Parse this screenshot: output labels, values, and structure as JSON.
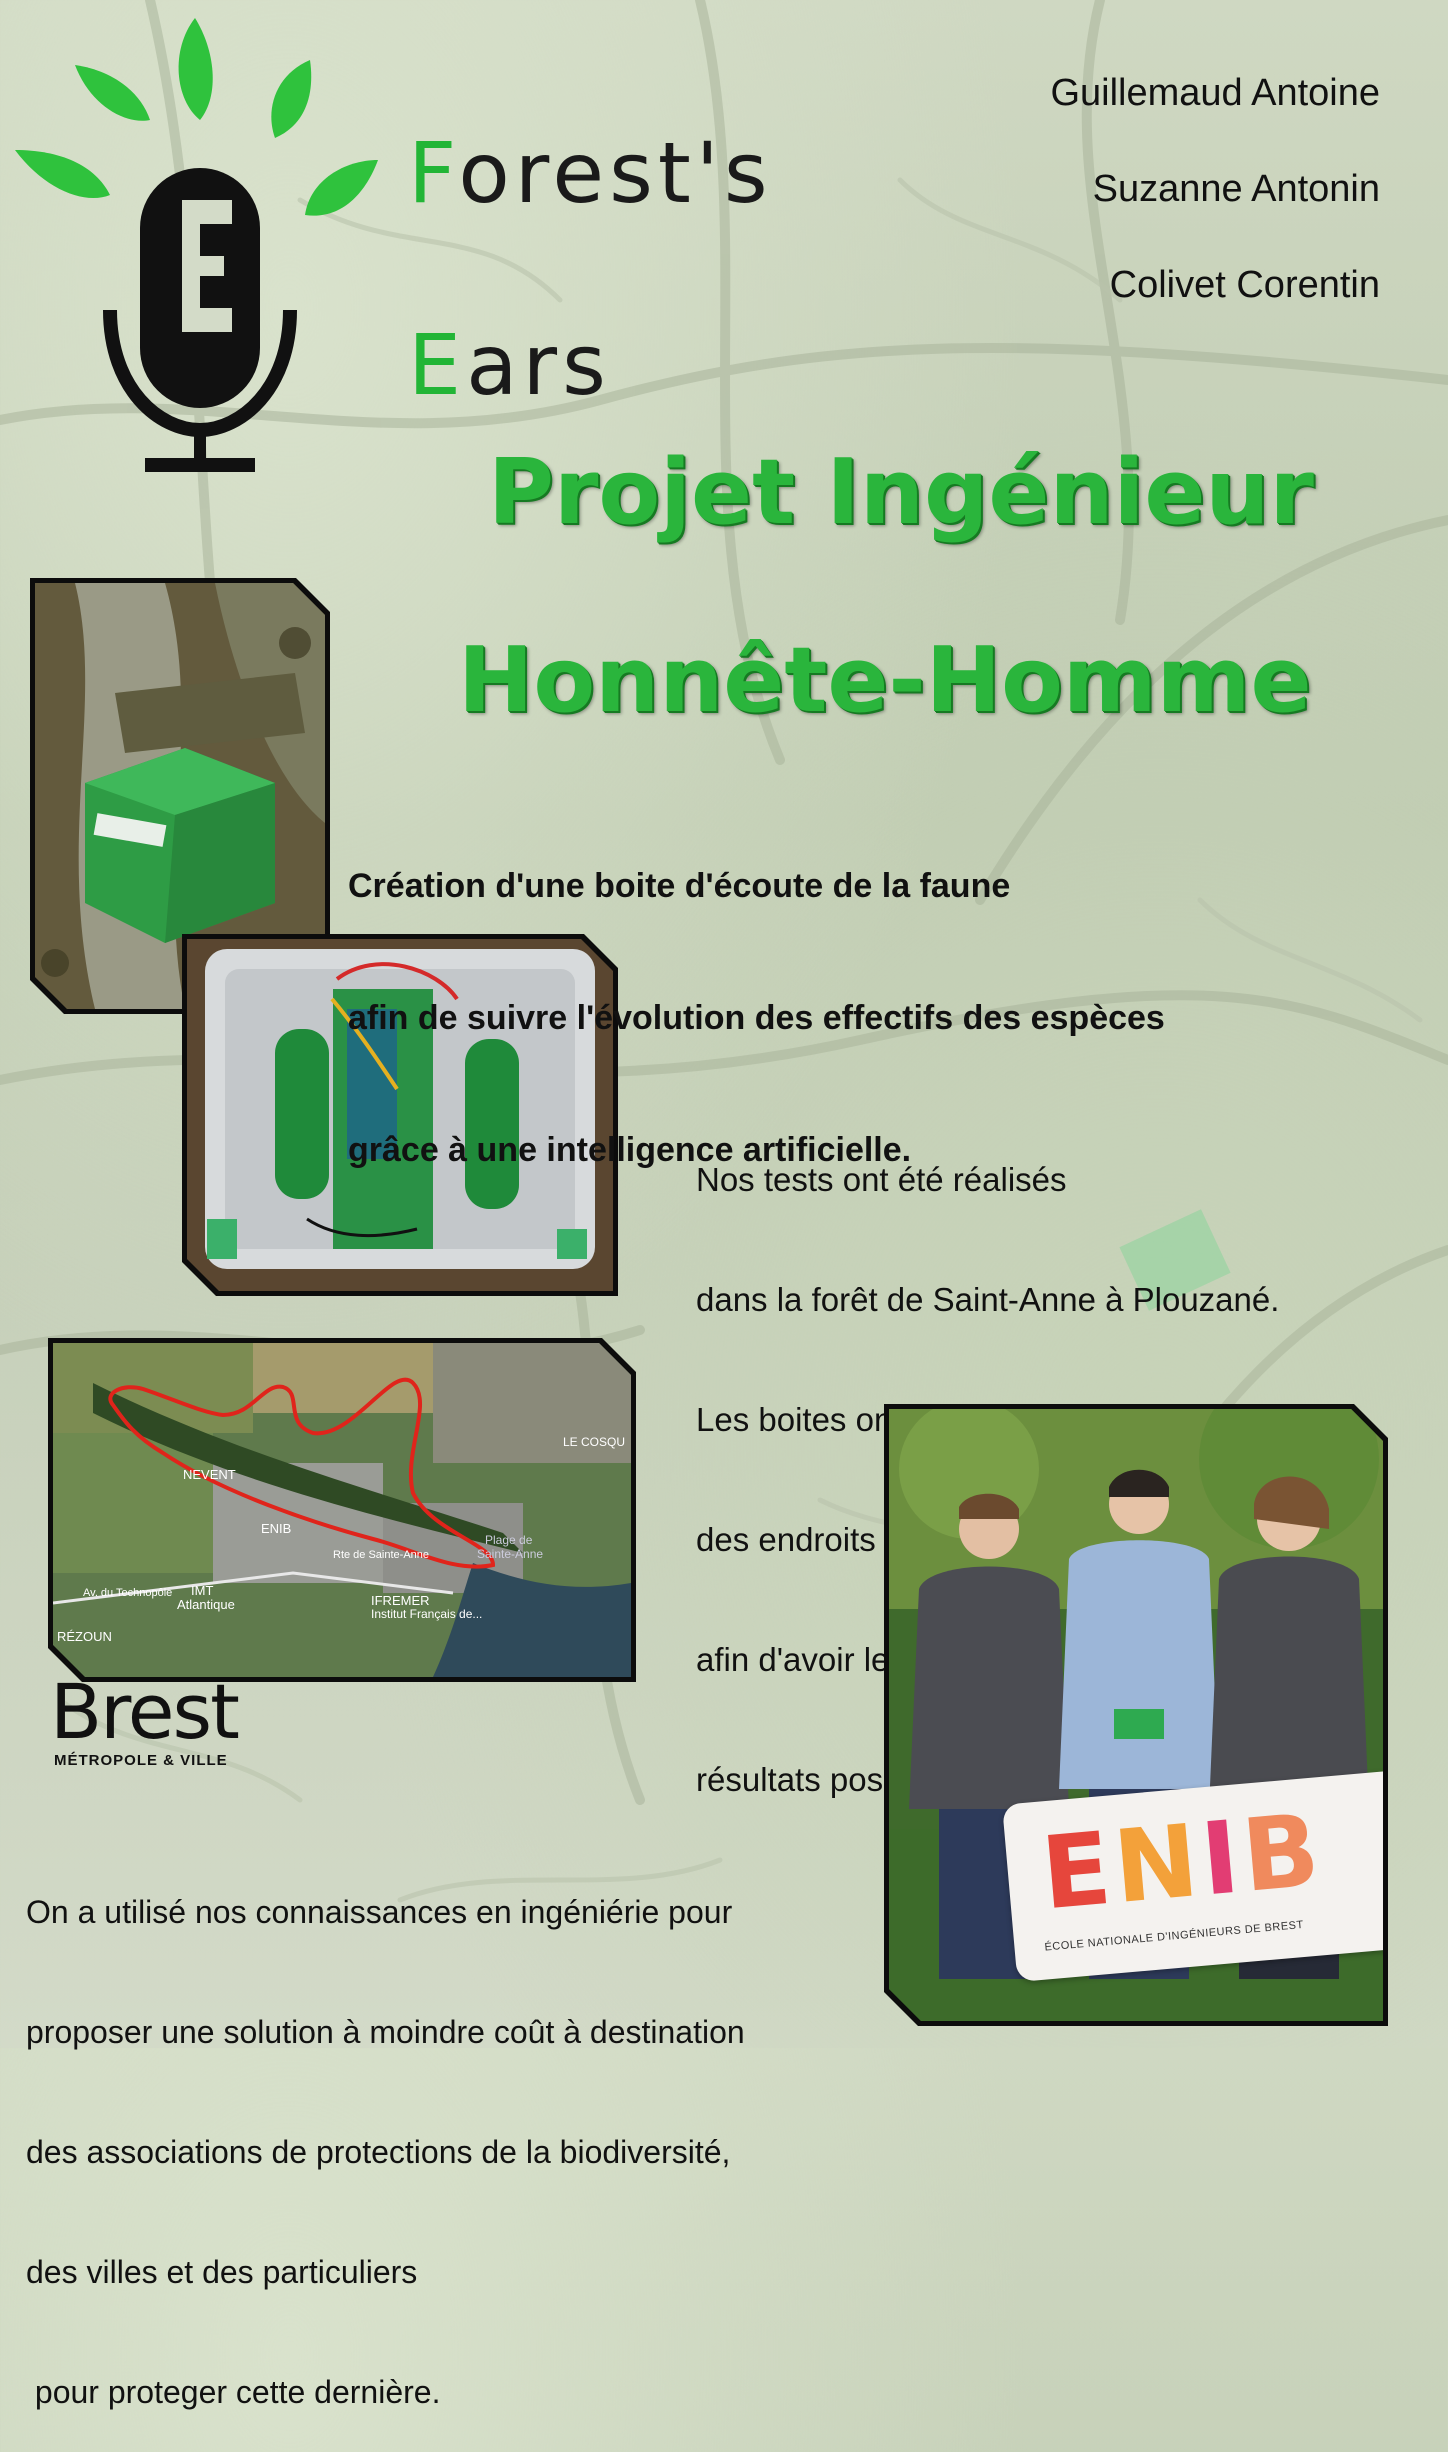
{
  "brand": {
    "word1_cap": "F",
    "word1_rest": "orest's",
    "word2_cap": "E",
    "word2_rest": "ars"
  },
  "authors": [
    "Guillemaud Antoine",
    "Suzanne Antonin",
    "Colivet Corentin"
  ],
  "headline": {
    "line1": "Projet Ingénieur",
    "line2": "Honnête-Homme"
  },
  "intro": {
    "lines": [
      "Création d'une boite d'écoute de la faune",
      "afin de suivre l'évolution des effectifs des espèces",
      "grâce à une intelligence artificielle."
    ]
  },
  "tests": {
    "lines": [
      "Nos tests ont été réalisés",
      "dans la forêt de Saint-Anne à Plouzané.",
      "Les boites ont été installées à",
      "des endroits stratégiques",
      "afin d'avoir les meilleurs",
      "résultats possibles."
    ]
  },
  "conclusion": {
    "lines": [
      "On a utilisé nos connaissances en ingéniérie pour",
      "proposer une solution à moindre coût à destination",
      "des associations de protections de la biodiversité,",
      "des villes et des particuliers",
      " pour proteger cette dernière."
    ]
  },
  "map_labels": {
    "nevent": "NEVENT",
    "enib": "ENIB",
    "imt": "IMT",
    "imt2": "Atlantique",
    "ifremer": "IFREMER",
    "ifremer2": "Institut Français de...",
    "cosqu": "LE COSQU",
    "rezoun": "RÉZOUN",
    "technopole": "Av. du Technopôle",
    "rte": "Rte de Sainte-Anne",
    "plage": "Plage de",
    "plage2": "Sainte-Anne"
  },
  "brest_logo": {
    "word": "Brest",
    "sub": "MÉTROPOLE & VILLE"
  },
  "enib_logo": {
    "word": "ENIB",
    "sub": "ÉCOLE NATIONALE D'INGÉNIEURS DE BREST"
  },
  "colors": {
    "brand_green": "#22b536",
    "headline_green": "#2ab53c",
    "route_red": "#e0241b"
  }
}
